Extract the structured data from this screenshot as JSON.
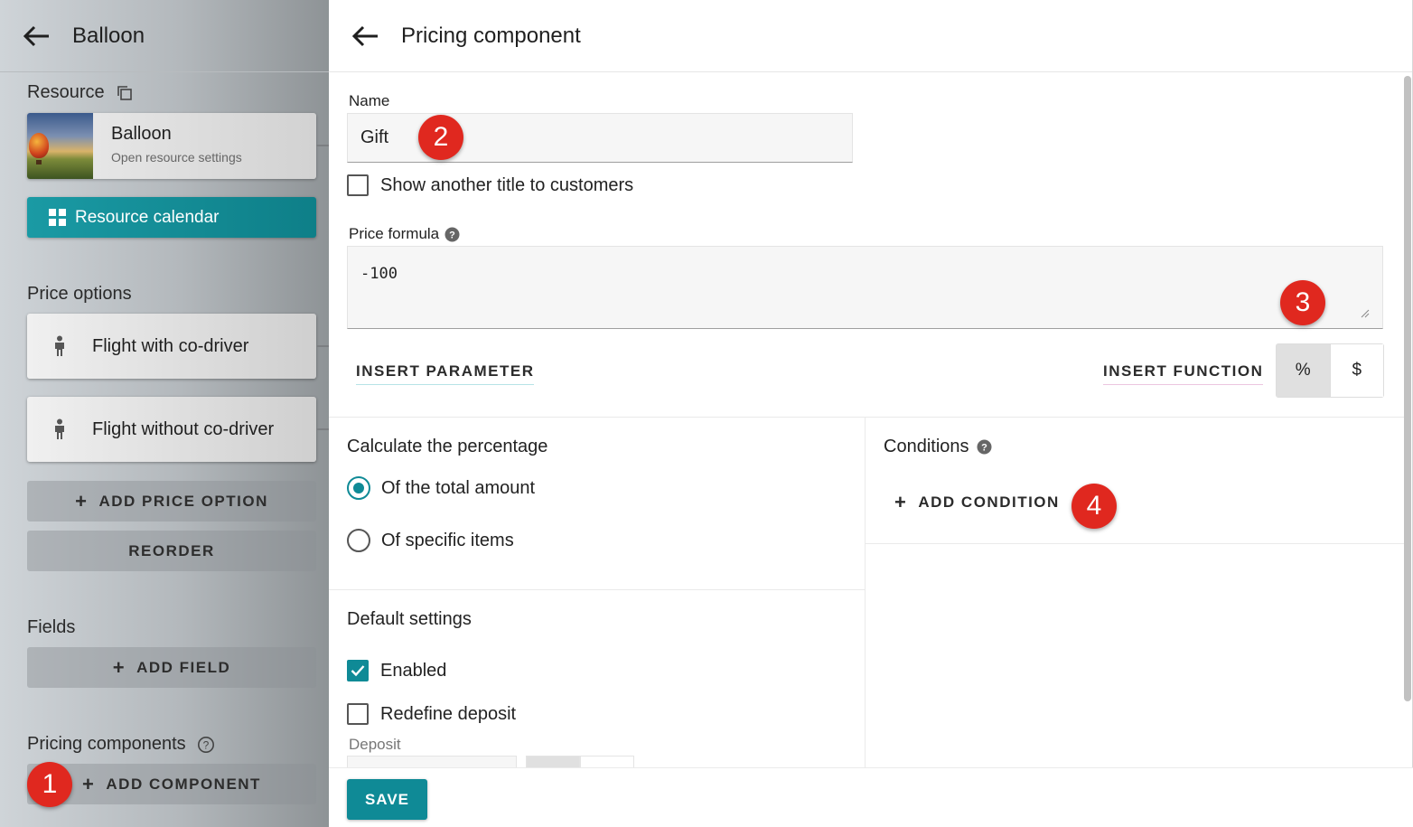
{
  "left": {
    "title": "Balloon",
    "resource_label": "Resource",
    "resource_card": {
      "name": "Balloon",
      "subtitle": "Open resource settings"
    },
    "resource_calendar": "Resource calendar",
    "price_options_label": "Price options",
    "price_options": [
      {
        "label": "Flight with co-driver"
      },
      {
        "label": "Flight without co-driver"
      }
    ],
    "add_price_option": "ADD PRICE OPTION",
    "reorder": "REORDER",
    "fields_label": "Fields",
    "add_field": "ADD FIELD",
    "pricing_components_label": "Pricing components",
    "add_component": "ADD COMPONENT"
  },
  "right": {
    "title": "Pricing component",
    "name_label": "Name",
    "name_value": "Gift",
    "show_title_label": "Show another title to customers",
    "show_title_checked": false,
    "formula_label": "Price formula",
    "formula_value": "-100",
    "insert_parameter": "INSERT PARAMETER",
    "insert_function": "INSERT FUNCTION",
    "toggle": {
      "percent": "%",
      "dollar": "$",
      "selected": "%"
    },
    "calc_heading": "Calculate the percentage",
    "calc_options": [
      {
        "label": "Of the total amount",
        "selected": true
      },
      {
        "label": "Of specific items",
        "selected": false
      }
    ],
    "conditions_heading": "Conditions",
    "add_condition": "ADD CONDITION",
    "default_settings_heading": "Default settings",
    "enabled_label": "Enabled",
    "enabled_checked": true,
    "redefine_deposit_label": "Redefine deposit",
    "redefine_deposit_checked": false,
    "deposit_label": "Deposit",
    "save": "SAVE"
  },
  "annotations": [
    "1",
    "2",
    "3",
    "4"
  ],
  "colors": {
    "accent": "#0f8a96",
    "badge": "#e0281f"
  }
}
